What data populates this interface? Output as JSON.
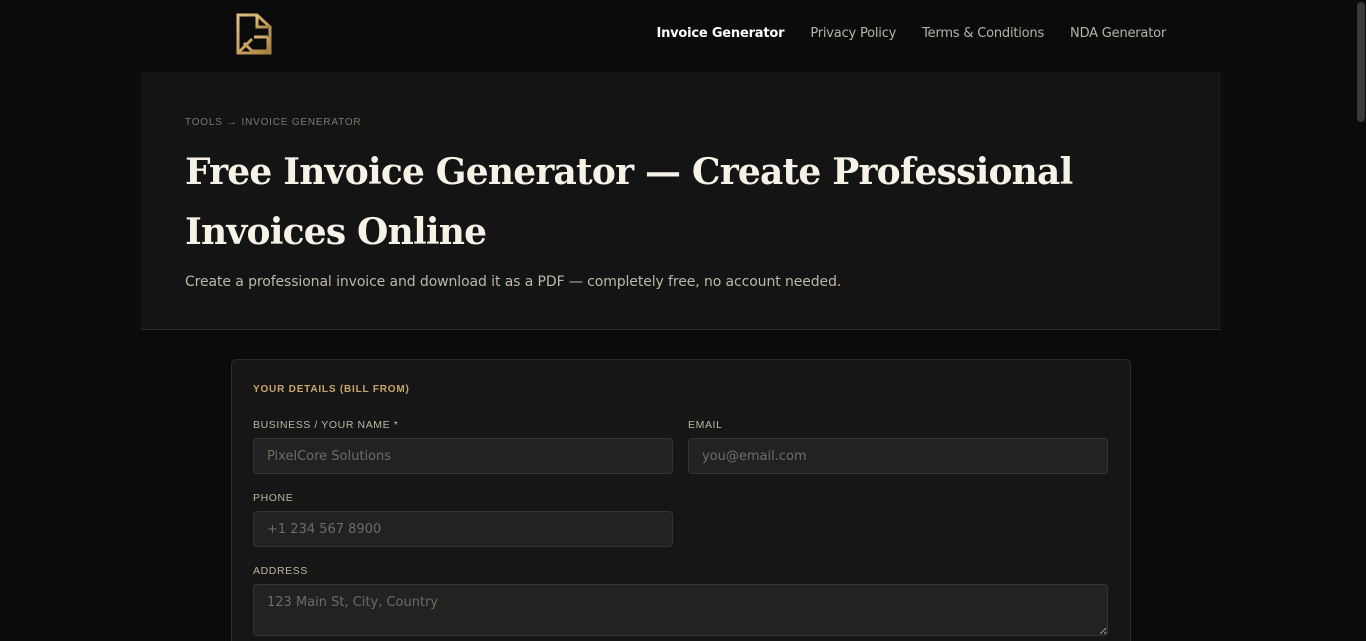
{
  "nav": {
    "items": [
      {
        "label": "Invoice Generator",
        "active": true
      },
      {
        "label": "Privacy Policy",
        "active": false
      },
      {
        "label": "Terms & Conditions",
        "active": false
      },
      {
        "label": "NDA Generator",
        "active": false
      }
    ]
  },
  "hero": {
    "breadcrumb": {
      "root": "TOOLS",
      "arrow": "→",
      "current": "INVOICE GENERATOR"
    },
    "title": "Free Invoice Generator — Create Professional Invoices Online",
    "subtitle": "Create a professional invoice and download it as a PDF — completely free, no account needed."
  },
  "form": {
    "section_title": "YOUR DETAILS (BILL FROM)",
    "fields": {
      "business": {
        "label": "BUSINESS / YOUR NAME *",
        "placeholder": "PixelCore Solutions"
      },
      "email": {
        "label": "EMAIL",
        "placeholder": "you@email.com"
      },
      "phone": {
        "label": "PHONE",
        "placeholder": "+1 234 567 8900"
      },
      "address": {
        "label": "ADDRESS",
        "placeholder": "123 Main St, City, Country"
      }
    }
  },
  "colors": {
    "background": "#0b0b0b",
    "hero_bg": "#141414",
    "accent_gold": "#c8a66a",
    "input_bg": "#222222"
  },
  "icons": {
    "logo": "document-g-logo-icon"
  }
}
